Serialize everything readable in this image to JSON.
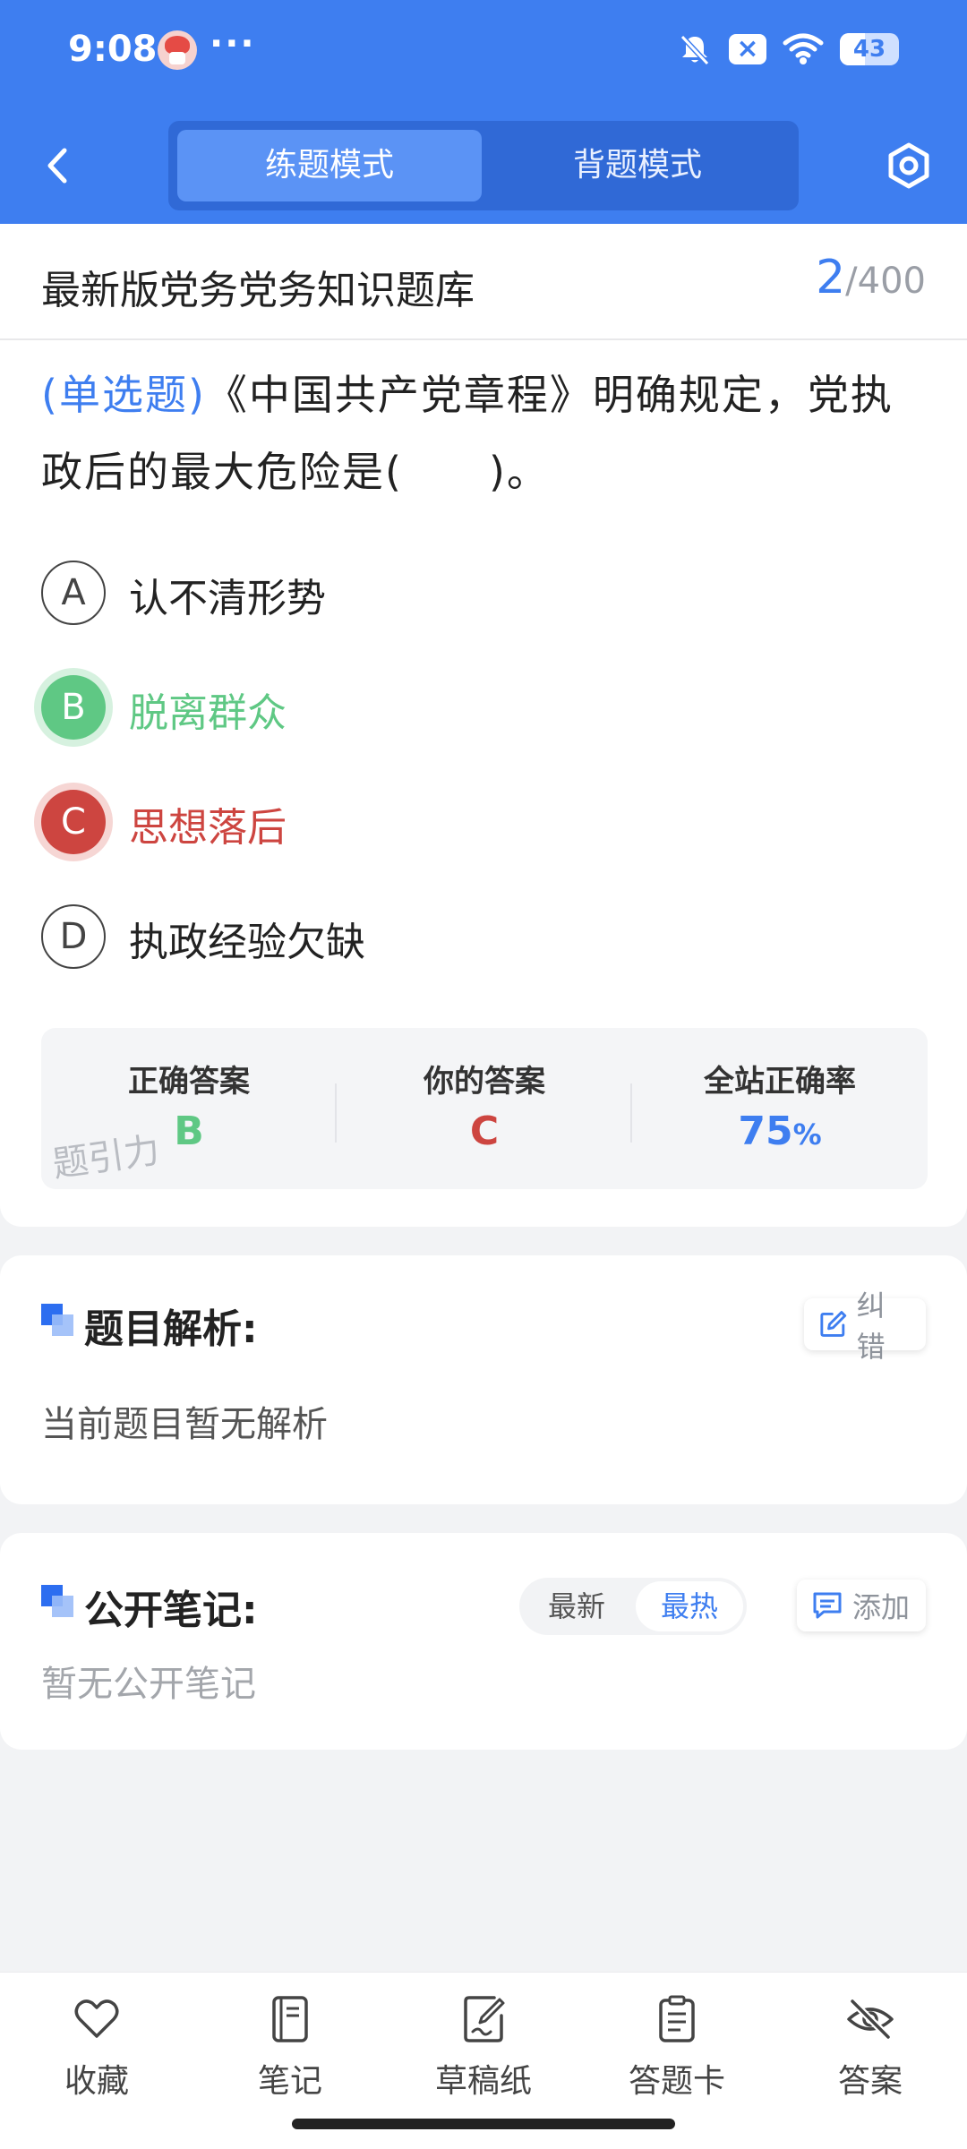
{
  "status_bar": {
    "time": "9:08",
    "dots": "···",
    "x_badge": "×",
    "battery": "43",
    "battery_level": 0.43
  },
  "header": {
    "modes": [
      {
        "label": "练题模式",
        "active": true
      },
      {
        "label": "背题模式",
        "active": false
      }
    ]
  },
  "bank": {
    "title": "最新版党务党务知识题库",
    "current": "2",
    "separator": "/",
    "total": "400"
  },
  "question": {
    "type": "(单选题)",
    "text": "《中国共产党章程》明确规定，党执政后的最大危险是(　　)。",
    "options": [
      {
        "letter": "A",
        "text": "认不清形势",
        "state": "normal"
      },
      {
        "letter": "B",
        "text": "脱离群众",
        "state": "correct"
      },
      {
        "letter": "C",
        "text": "思想落后",
        "state": "wrong"
      },
      {
        "letter": "D",
        "text": "执政经验欠缺",
        "state": "normal"
      }
    ]
  },
  "result": {
    "correct_label": "正确答案",
    "correct_value": "B",
    "yours_label": "你的答案",
    "yours_value": "C",
    "rate_label": "全站正确率",
    "rate_value": "75",
    "rate_unit": "%",
    "watermark": "题引力"
  },
  "analysis": {
    "title": "题目解析:",
    "report_label": "纠错",
    "text": "当前题目暂无解析"
  },
  "notes": {
    "title": "公开笔记:",
    "sort_options": [
      "最新",
      "最热"
    ],
    "active_sort": "最热",
    "add_label": "添加",
    "empty_text": "暂无公开笔记"
  },
  "bottom_nav": [
    {
      "label": "收藏",
      "icon": "heart-icon"
    },
    {
      "label": "笔记",
      "icon": "notebook-icon"
    },
    {
      "label": "草稿纸",
      "icon": "draft-paper-icon"
    },
    {
      "label": "答题卡",
      "icon": "answer-sheet-icon"
    },
    {
      "label": "答案",
      "icon": "eye-off-icon"
    }
  ],
  "colors": {
    "primary": "#3e7ef0",
    "correct": "#5fc884",
    "wrong": "#cd4540",
    "background": "#f2f3f5"
  }
}
